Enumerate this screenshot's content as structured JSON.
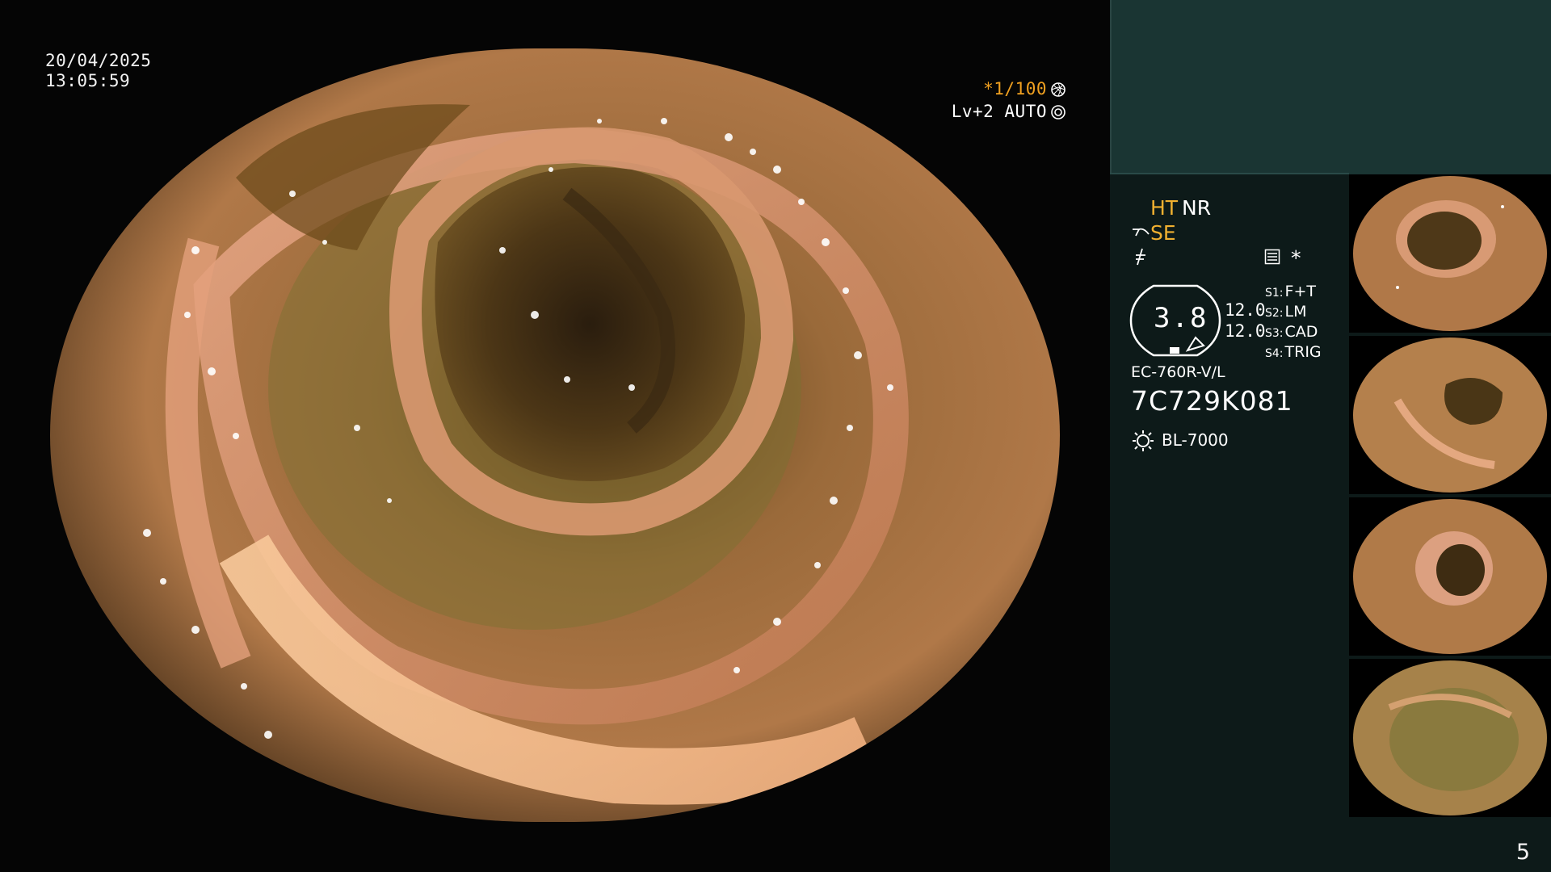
{
  "overlay": {
    "date": "20/04/2025",
    "time": "13:05:59",
    "shutter": "*1/100",
    "shutter_icon": "aperture-icon",
    "level": "Lv+2 AUTO",
    "level_icon": "iris-icon"
  },
  "settings": {
    "ht": "HT",
    "nr": "NR",
    "se": "SE",
    "star": "*",
    "gauge_value": "3.8",
    "value_a": "12.0",
    "value_b": "12.0",
    "slots": [
      {
        "key": "S1:",
        "value": "F+T"
      },
      {
        "key": "S2:",
        "value": "LM"
      },
      {
        "key": "S3:",
        "value": "CAD"
      },
      {
        "key": "S4:",
        "value": "TRIG"
      }
    ],
    "scope_model": "EC-760R-V/L",
    "serial": "7C729K081",
    "light_source": "BL-7000"
  },
  "thumbnails": [
    {
      "label": "captured-frame-1"
    },
    {
      "label": "captured-frame-2"
    },
    {
      "label": "captured-frame-3"
    },
    {
      "label": "captured-frame-4"
    }
  ],
  "page_number": "5",
  "colors": {
    "background": "#050505",
    "panel_top": "#1a3533",
    "panel_bottom": "#0d1a19",
    "accent_orange": "#f0b030"
  }
}
